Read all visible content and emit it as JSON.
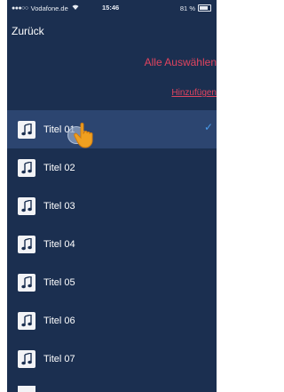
{
  "status_bar": {
    "signal": "●●●○○",
    "carrier": "Vodafone.de",
    "wifi_icon": "wifi-icon",
    "time": "15:46",
    "battery": "81 %"
  },
  "nav": {
    "back_label": "Zurück",
    "select_all_label": "Alle Auswählen",
    "add_label": "Hinzufügen"
  },
  "tracks": [
    {
      "title": "Titel 01",
      "selected": true
    },
    {
      "title": "Titel 02",
      "selected": false
    },
    {
      "title": "Titel 03",
      "selected": false
    },
    {
      "title": "Titel 04",
      "selected": false
    },
    {
      "title": "Titel 05",
      "selected": false
    },
    {
      "title": "Titel 06",
      "selected": false
    },
    {
      "title": "Titel 07",
      "selected": false
    }
  ],
  "colors": {
    "background": "#1b2f50",
    "selected_row": "#2c4570",
    "accent": "#e0445f",
    "check": "#4a9bea"
  }
}
